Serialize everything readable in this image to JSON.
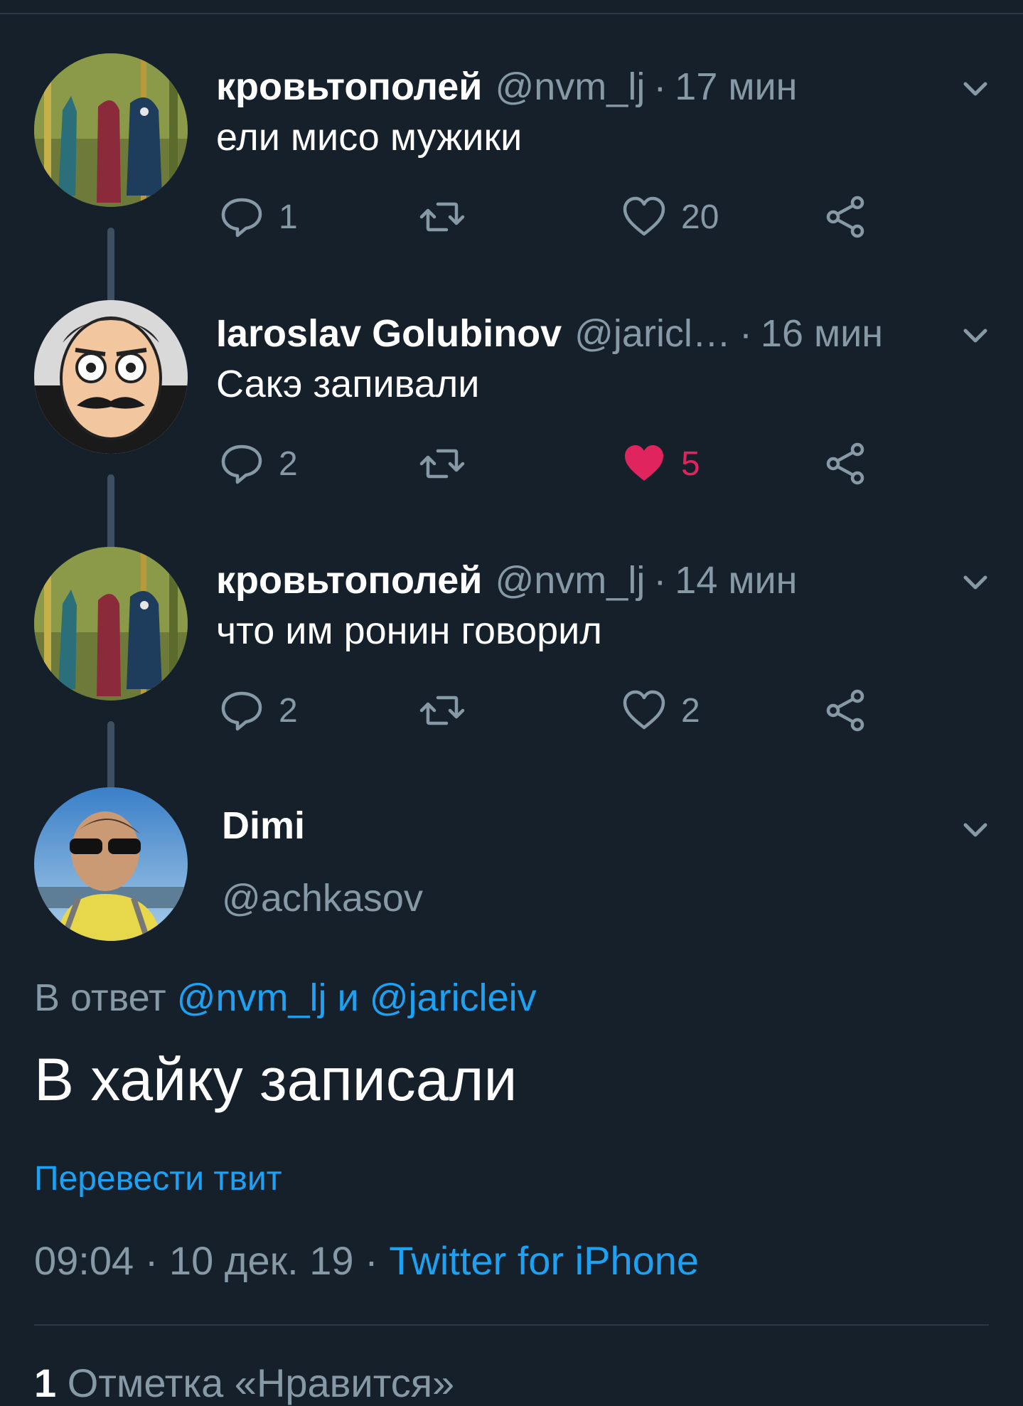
{
  "thread": [
    {
      "name": "кровьтополей",
      "handle": "@nvm_lj",
      "time": "17 мин",
      "text": "ели мисо мужики",
      "replies": "1",
      "retweets": "",
      "likes": "20",
      "liked": false,
      "avatar": "forest-birds-painting"
    },
    {
      "name": "Iaroslav Golubinov",
      "handle": "@jaricl…",
      "time": "16 мин",
      "text": "Сакэ запивали",
      "replies": "2",
      "retweets": "",
      "likes": "5",
      "liked": true,
      "avatar": "cartoon-mustache-face"
    },
    {
      "name": "кровьтополей",
      "handle": "@nvm_lj",
      "time": "14 мин",
      "text": "что им ронин говорил",
      "replies": "2",
      "retweets": "",
      "likes": "2",
      "liked": false,
      "avatar": "forest-birds-painting"
    }
  ],
  "main": {
    "name": "Dimi",
    "handle": "@achkasov",
    "reply_prefix": "В ответ",
    "reply_user1": "@nvm_lj",
    "reply_and": "и",
    "reply_user2": "@jaricleiv",
    "text": "В хайку записали",
    "translate": "Перевести твит",
    "time": "09:04",
    "date": "10 дек. 19",
    "source": "Twitter for iPhone",
    "likes_count": "1",
    "likes_label": "Отметка «Нравится»"
  },
  "colors": {
    "background": "#15202b",
    "secondary_text": "#8899a6",
    "link": "#1da1f2",
    "like_red": "#e0245e"
  }
}
